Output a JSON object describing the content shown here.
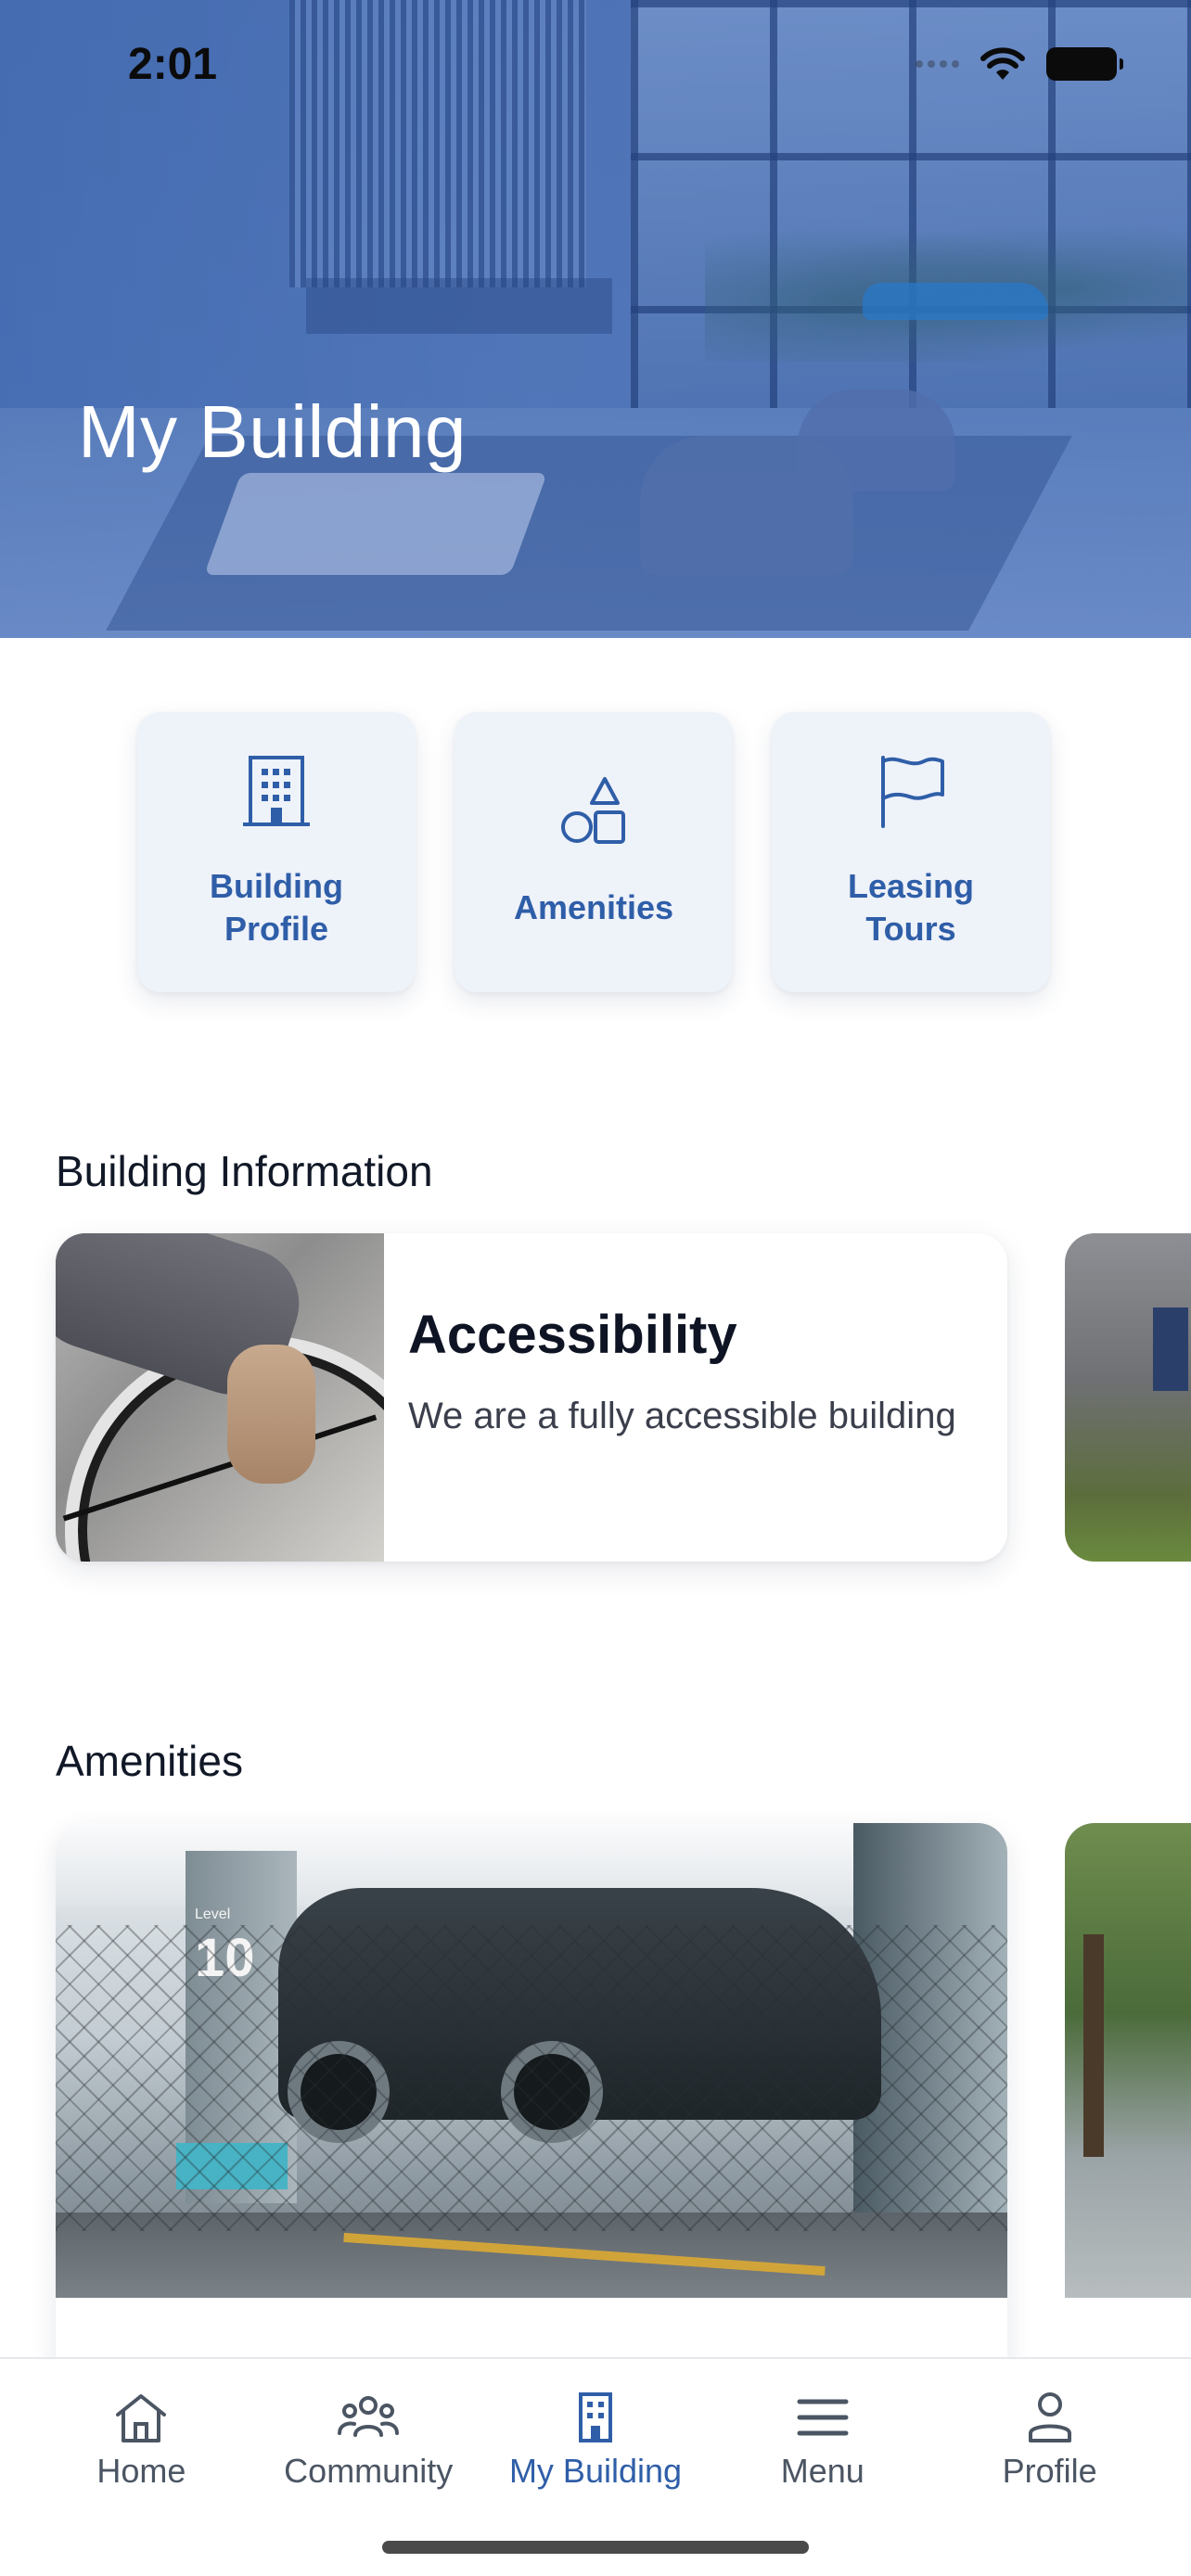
{
  "status_bar": {
    "time": "2:01"
  },
  "hero": {
    "title": "My Building"
  },
  "quick_tiles": [
    {
      "label": "Building\nProfile",
      "icon": "building-icon"
    },
    {
      "label": "Amenities",
      "icon": "shapes-icon"
    },
    {
      "label": "Leasing\nTours",
      "icon": "flag-icon"
    }
  ],
  "building_information": {
    "section_title": "Building Information",
    "cards": [
      {
        "title": "Accessibility",
        "description": "We are a fully accessible building",
        "image": "wheelchair-photo"
      }
    ]
  },
  "amenities": {
    "section_title": "Amenities",
    "cards": [
      {
        "image": "parking-garage-photo",
        "pillar_text": "10",
        "pillar_small_text": "Level"
      }
    ]
  },
  "tab_bar": {
    "active": "My Building",
    "tabs": [
      {
        "label": "Home",
        "icon": "home-icon"
      },
      {
        "label": "Community",
        "icon": "community-icon"
      },
      {
        "label": "My Building",
        "icon": "building-icon"
      },
      {
        "label": "Menu",
        "icon": "menu-icon"
      },
      {
        "label": "Profile",
        "icon": "person-icon"
      }
    ]
  },
  "colors": {
    "accent": "#2f5ea8",
    "tile_background": "#eef2f9",
    "hero_tint": "#4f74b5"
  }
}
